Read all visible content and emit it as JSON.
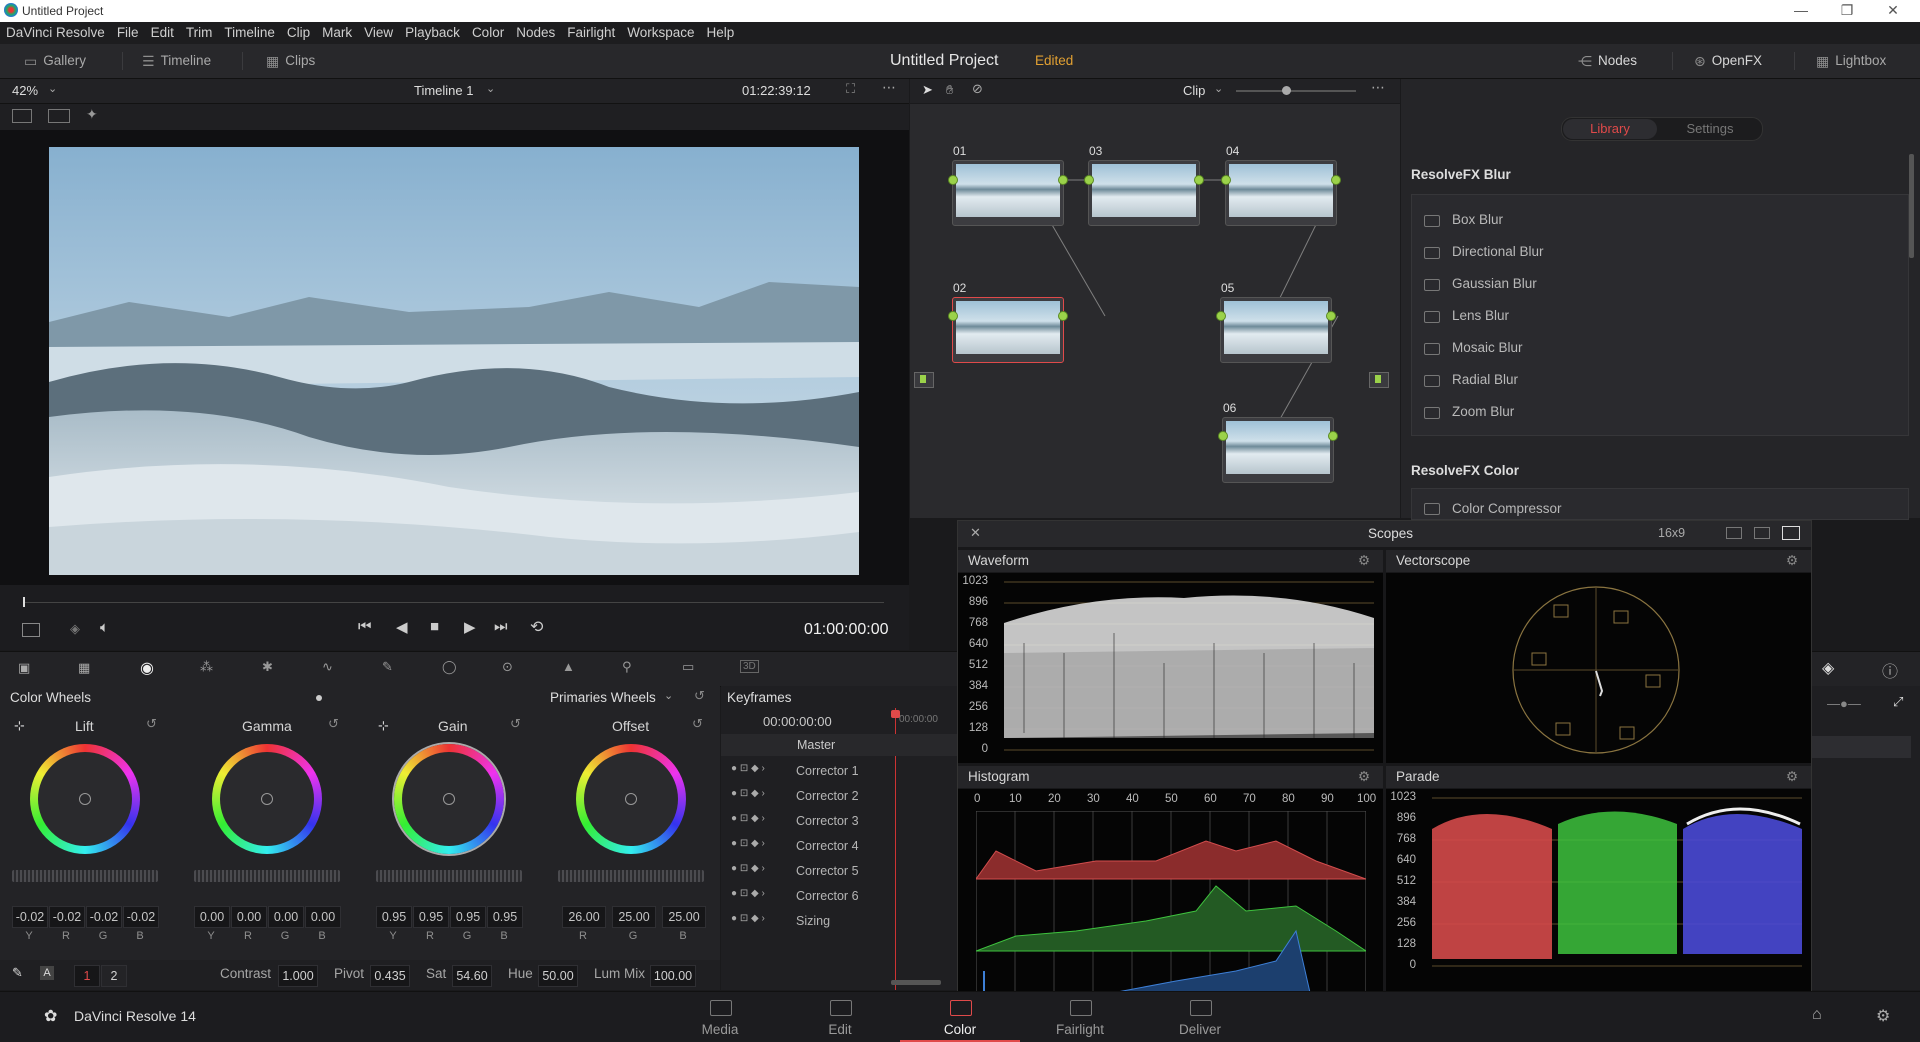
{
  "window": {
    "title": "Untitled Project",
    "min": "—",
    "max": "❐",
    "close": "✕"
  },
  "menu": [
    "DaVinci Resolve",
    "File",
    "Edit",
    "Trim",
    "Timeline",
    "Clip",
    "Mark",
    "View",
    "Playback",
    "Color",
    "Nodes",
    "Fairlight",
    "Workspace",
    "Help"
  ],
  "toolbar": {
    "gallery": "Gallery",
    "timeline": "Timeline",
    "clips": "Clips",
    "project_title": "Untitled Project",
    "edited": "Edited",
    "nodes": "Nodes",
    "openfx": "OpenFX",
    "lightbox": "Lightbox"
  },
  "viewer": {
    "zoom": "42%",
    "timeline_name": "Timeline 1",
    "timecode_top": "01:22:39:12",
    "timecode": "01:00:00:00"
  },
  "node_editor": {
    "mode": "Clip",
    "nodes": [
      "01",
      "02",
      "03",
      "04",
      "05",
      "06"
    ]
  },
  "library": {
    "tab_library": "Library",
    "tab_settings": "Settings",
    "section1": "ResolveFX Blur",
    "items": [
      "Box Blur",
      "Directional Blur",
      "Gaussian Blur",
      "Lens Blur",
      "Mosaic Blur",
      "Radial Blur",
      "Zoom Blur"
    ],
    "section2": "ResolveFX Color",
    "partial_item": "Color Compressor"
  },
  "scopes": {
    "title": "Scopes",
    "layout": "16x9",
    "waveform": "Waveform",
    "vectorscope": "Vectorscope",
    "histogram": "Histogram",
    "parade": "Parade",
    "y_ticks": [
      "1023",
      "896",
      "768",
      "640",
      "512",
      "384",
      "256",
      "128",
      "0"
    ],
    "hist_ticks": [
      "0",
      "10",
      "20",
      "30",
      "40",
      "50",
      "60",
      "70",
      "80",
      "90",
      "100"
    ]
  },
  "color_wheels": {
    "title": "Color Wheels",
    "mode": "Primaries Wheels",
    "wheels": [
      {
        "name": "Lift",
        "values": [
          "-0.02",
          "-0.02",
          "-0.02",
          "-0.02"
        ],
        "labels": [
          "Y",
          "R",
          "G",
          "B"
        ]
      },
      {
        "name": "Gamma",
        "values": [
          "0.00",
          "0.00",
          "0.00",
          "0.00"
        ],
        "labels": [
          "Y",
          "R",
          "G",
          "B"
        ]
      },
      {
        "name": "Gain",
        "values": [
          "0.95",
          "0.95",
          "0.95",
          "0.95"
        ],
        "labels": [
          "Y",
          "R",
          "G",
          "B"
        ]
      },
      {
        "name": "Offset",
        "values": [
          "26.00",
          "25.00",
          "25.00"
        ],
        "labels": [
          "R",
          "G",
          "B"
        ]
      }
    ],
    "page1": "1",
    "page2": "2",
    "contrast_label": "Contrast",
    "contrast": "1.000",
    "pivot_label": "Pivot",
    "pivot": "0.435",
    "sat_label": "Sat",
    "sat": "54.60",
    "hue_label": "Hue",
    "hue": "50.00",
    "lummix_label": "Lum Mix",
    "lummix": "100.00"
  },
  "keyframes": {
    "title": "Keyframes",
    "timecode": "00:00:00:00",
    "ruler_tc": "00:00:00",
    "master": "Master",
    "rows": [
      "Corrector 1",
      "Corrector 2",
      "Corrector 3",
      "Corrector 4",
      "Corrector 5",
      "Corrector 6",
      "Sizing"
    ]
  },
  "pages": {
    "app": "DaVinci Resolve 14",
    "tabs": [
      "Media",
      "Edit",
      "Color",
      "Fairlight",
      "Deliver"
    ],
    "active": "Color"
  },
  "colors": {
    "accent": "#e1a032",
    "active_tab": "#e04a4a",
    "node_link": "#9bd24a"
  }
}
